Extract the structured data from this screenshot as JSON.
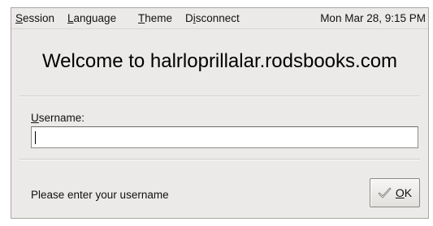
{
  "menubar": {
    "items": [
      {
        "accel": "S",
        "rest": "ession"
      },
      {
        "accel": "L",
        "rest": "anguage"
      },
      {
        "accel": "T",
        "rest": "heme"
      },
      {
        "first": "D",
        "accel": "i",
        "rest": "sconnect"
      }
    ],
    "clock": "Mon Mar 28,  9:15 PM"
  },
  "welcome": "Welcome to halrloprillalar.rodsbooks.com",
  "username": {
    "label_accel": "U",
    "label_rest": "sername:",
    "value": ""
  },
  "status": "Please enter your username",
  "ok": {
    "accel": "O",
    "rest": "K",
    "icon": "check-icon"
  }
}
